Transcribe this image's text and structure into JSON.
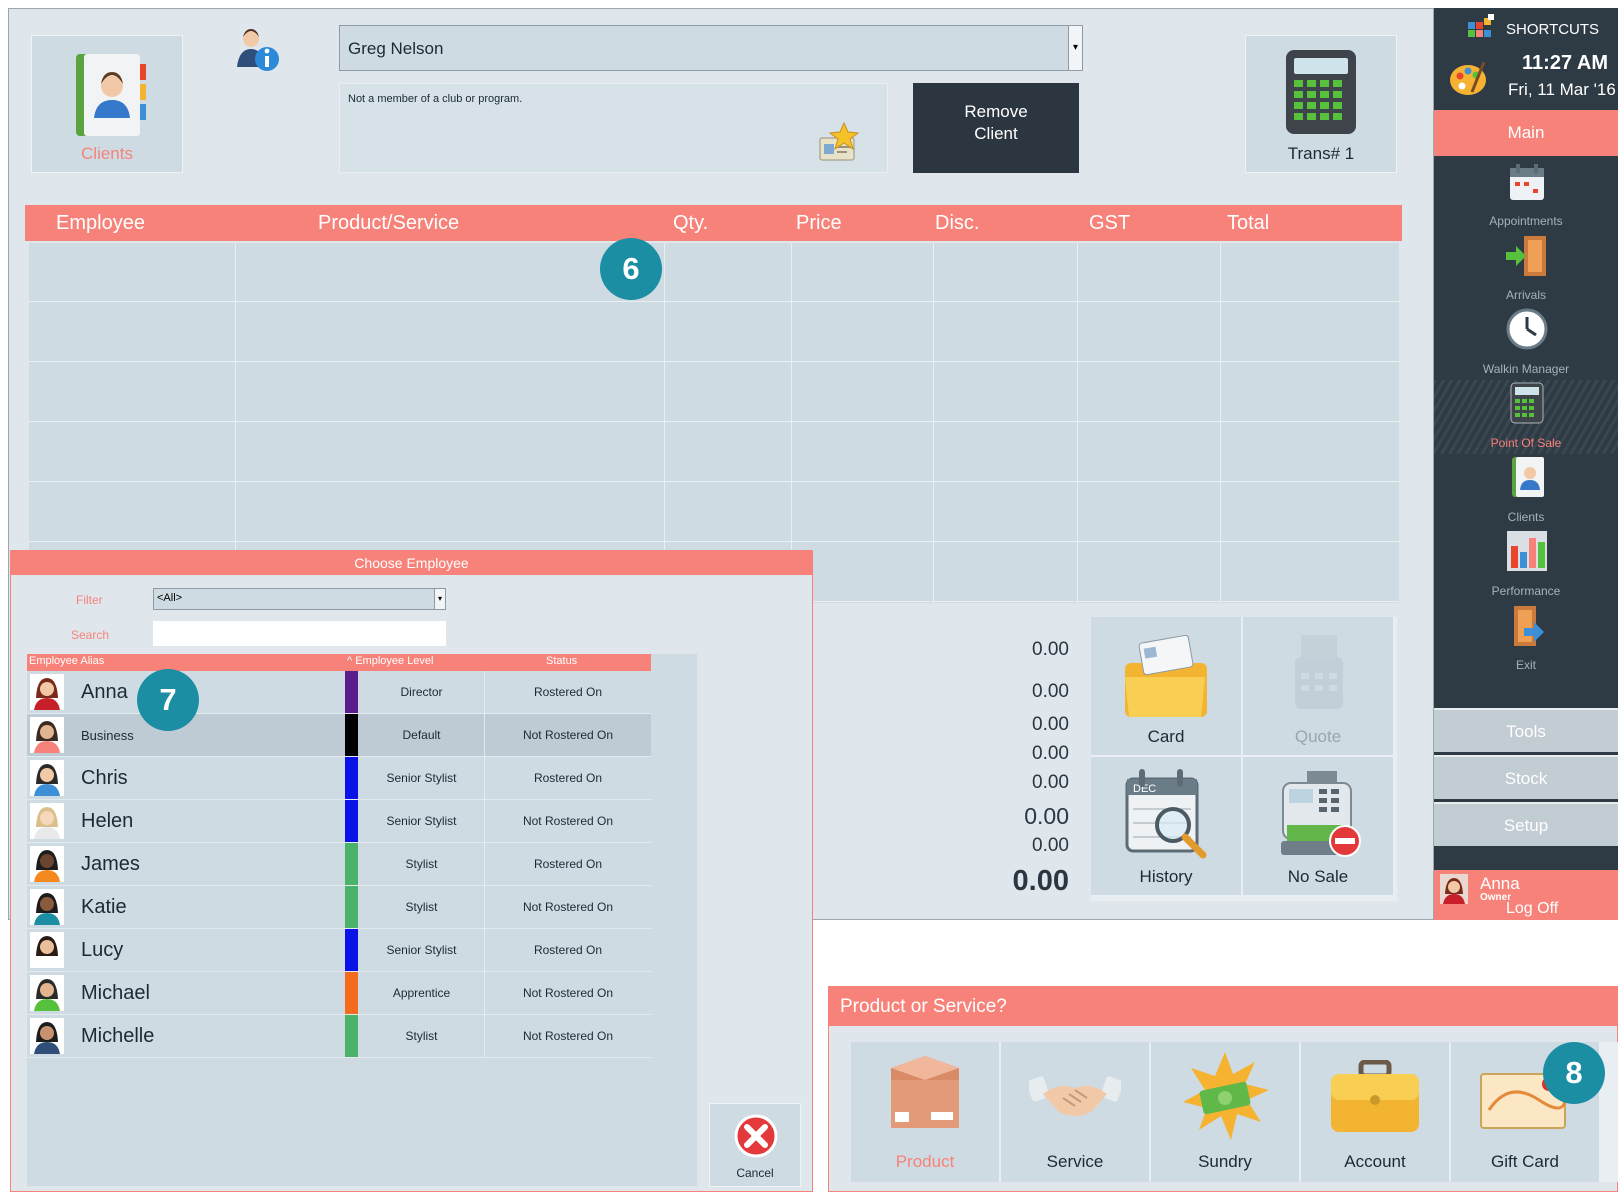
{
  "header": {
    "clients_label": "Clients",
    "client_name": "Greg Nelson",
    "club_status": "Not a member of a club or program.",
    "remove_client": [
      "Remove",
      "Client"
    ],
    "trans_label": "Trans# 1"
  },
  "grid": {
    "columns": [
      "Employee",
      "Product/Service",
      "Qty.",
      "Price",
      "Disc.",
      "GST",
      "Total"
    ]
  },
  "markers": {
    "m6": "6",
    "m7": "7",
    "m8": "8"
  },
  "totals": [
    "0.00",
    "0.00",
    "0.00",
    "0.00",
    "0.00",
    "0.00",
    "0.00",
    "0.00"
  ],
  "actions": {
    "card": "Card",
    "quote": "Quote",
    "history": "History",
    "no_sale": "No Sale"
  },
  "sidebar": {
    "title": "SHORTCUTS",
    "time": "11:27 AM",
    "date": "Fri, 11 Mar '16",
    "main": "Main",
    "items": [
      "Appointments",
      "Arrivals",
      "Walkin Manager",
      "Point Of Sale",
      "Clients",
      "Performance",
      "Exit"
    ],
    "tabs": [
      "Tools",
      "Stock",
      "Setup"
    ],
    "user_name": "Anna",
    "user_role": "Owner",
    "logoff": "Log Off"
  },
  "employee_dialog": {
    "title": "Choose Employee",
    "filter_label": "Filter",
    "filter_value": "<All>",
    "search_label": "Search",
    "headers": [
      "Employee Alias",
      "^ Employee Level",
      "Status"
    ],
    "rows": [
      {
        "name": "Anna",
        "level": "Director",
        "status": "Rostered On",
        "color": "#5b1c8c"
      },
      {
        "name": "Business",
        "level": "Default",
        "status": "Not Rostered On",
        "color": "#000000"
      },
      {
        "name": "Chris",
        "level": "Senior Stylist",
        "status": "Rostered On",
        "color": "#0a12e8"
      },
      {
        "name": "Helen",
        "level": "Senior Stylist",
        "status": "Not Rostered On",
        "color": "#0a12e8"
      },
      {
        "name": "James",
        "level": "Stylist",
        "status": "Rostered On",
        "color": "#4bb26a"
      },
      {
        "name": "Katie",
        "level": "Stylist",
        "status": "Not Rostered On",
        "color": "#4bb26a"
      },
      {
        "name": "Lucy",
        "level": "Senior Stylist",
        "status": "Rostered On",
        "color": "#0a12e8"
      },
      {
        "name": "Michael",
        "level": "Apprentice",
        "status": "Not Rostered On",
        "color": "#f46b1d"
      },
      {
        "name": "Michelle",
        "level": "Stylist",
        "status": "Not Rostered On",
        "color": "#4bb26a"
      }
    ],
    "cancel": "Cancel"
  },
  "product_dialog": {
    "title": "Product or Service?",
    "buttons": [
      "Product",
      "Service",
      "Sundry",
      "Account",
      "Gift Card"
    ]
  },
  "colors": {
    "accent": "#f7827a",
    "dark": "#2e3a44",
    "panel": "#cfdbe3",
    "marker": "#1b8ea4"
  }
}
